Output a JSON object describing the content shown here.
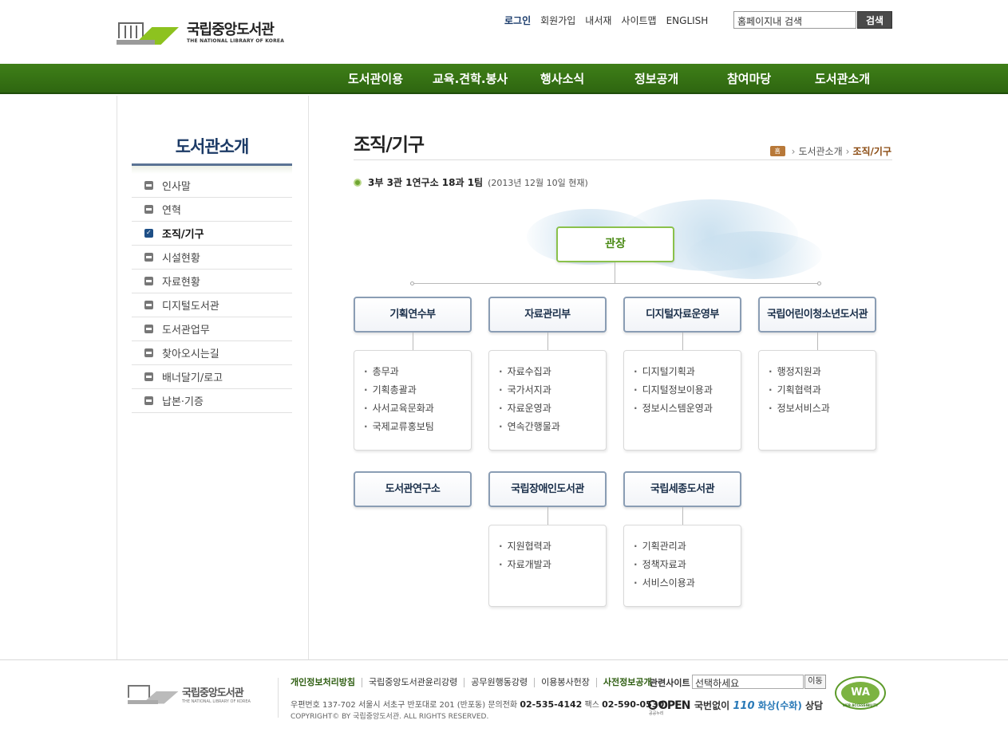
{
  "header": {
    "logo_kr": "국립중앙도서관",
    "logo_en": "THE NATIONAL LIBRARY OF KOREA",
    "util": [
      "로그인",
      "회원가입",
      "내서재",
      "사이트맵",
      "ENGLISH"
    ],
    "search_value": "홈페이지내 검색",
    "search_button": "검색"
  },
  "gnb": [
    "도서관이용",
    "교육.견학.봉사",
    "행사소식",
    "정보공개",
    "참여마당",
    "도서관소개"
  ],
  "lnb": {
    "title": "도서관소개",
    "items": [
      "인사말",
      "연혁",
      "조직/기구",
      "시설현황",
      "자료현황",
      "디지털도서관",
      "도서관업무",
      "찾아오시는길",
      "배너달기/로고",
      "납본·기증"
    ],
    "active_index": 2
  },
  "content": {
    "title": "조직/기구",
    "breadcrumb": {
      "home": "홈",
      "level1": "도서관소개",
      "current": "조직/기구"
    },
    "summary": "3부 3관 1연구소 18과 1팀",
    "summary_date": "(2013년 12월 10일 현재)"
  },
  "org": {
    "head": "관장",
    "depts": [
      {
        "name": "기획연수부",
        "subs": [
          "총무과",
          "기획총괄과",
          "사서교육문화과",
          "국제교류홍보팀"
        ]
      },
      {
        "name": "자료관리부",
        "subs": [
          "자료수집과",
          "국가서지과",
          "자료운영과",
          "연속간행물과"
        ]
      },
      {
        "name": "디지털자료운영부",
        "subs": [
          "디지털기획과",
          "디지털정보이용과",
          "정보시스템운영과"
        ]
      },
      {
        "name": "국립어린이청소년도서관",
        "subs": [
          "행정지원과",
          "기획협력과",
          "정보서비스과"
        ]
      },
      {
        "name": "도서관연구소",
        "subs": []
      },
      {
        "name": "국립장애인도서관",
        "subs": [
          "지원협력과",
          "자료개발과"
        ]
      },
      {
        "name": "국립세종도서관",
        "subs": [
          "기획관리과",
          "정책자료과",
          "서비스이용과"
        ]
      }
    ]
  },
  "footer": {
    "logo_kr": "국립중앙도서관",
    "logo_en": "THE NATIONAL LIBRARY OF KOREA",
    "links": [
      "개인정보처리방침",
      "국립중앙도서관윤리강령",
      "공무원행동강령",
      "이용봉사헌장",
      "사전정보공개"
    ],
    "related_label": "관련사이트",
    "related_value": "선택하세요",
    "related_button": "이동",
    "addr_prefix": "우편번호 137-702 서울시 서초구 반포대로 201 (반포동)  문의전화",
    "tel": "02-535-4142",
    "fax_label": "팩스",
    "fax": "02-590-0530",
    "copyright": "COPYRIGHT© BY 국립중앙도서관. ALL RIGHTS RESERVED.",
    "open_label": "OPEN",
    "open_sub": "공공누리",
    "phone_prefix": "국번없이",
    "phone_num": "110",
    "phone_mid": "화상(수화)",
    "phone_suffix": "상담",
    "wa_label": "WA",
    "wa_sub": "WEB ACCESSIBILITY"
  }
}
